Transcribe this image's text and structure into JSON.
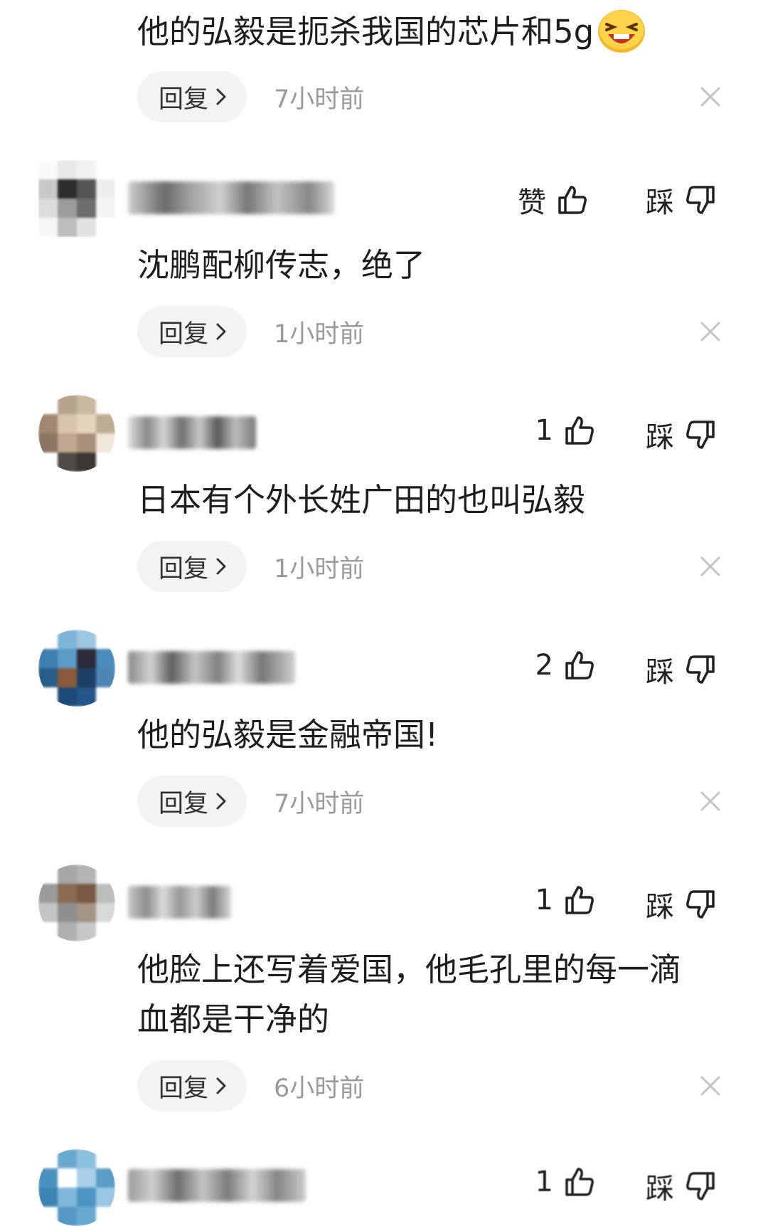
{
  "icons": {
    "reply_chevron": "chevron-right-icon",
    "like": "thumbs-up-icon",
    "dislike": "thumbs-down-icon",
    "close": "close-icon",
    "emoji": "laughing-emoji-icon"
  },
  "colors": {
    "background": "#ffffff",
    "reply_pill": "#f3f3f3",
    "time_text": "#9a9a9a",
    "main_text": "#1e1e1e"
  },
  "first": {
    "text": "他的弘毅是扼杀我国的芯片和5g",
    "reply_label": "回复",
    "time": "7小时前"
  },
  "comments": [
    {
      "like_label": "赞",
      "dislike_label": "踩",
      "text": "沈鹏配柳传志，绝了",
      "reply_label": "回复",
      "time": "1小时前"
    },
    {
      "like_label": "1",
      "dislike_label": "踩",
      "text": "日本有个外长姓广田的也叫弘毅",
      "reply_label": "回复",
      "time": "1小时前"
    },
    {
      "like_label": "2",
      "dislike_label": "踩",
      "text": "他的弘毅是金融帝国!",
      "reply_label": "回复",
      "time": "7小时前"
    },
    {
      "like_label": "1",
      "dislike_label": "踩",
      "text_line1": "他脸上还写着爱国，他毛孔里的每一滴",
      "text_line2": "血都是干净的",
      "reply_label": "回复",
      "time": "6小时前"
    },
    {
      "like_label": "1",
      "dislike_label": "踩"
    }
  ]
}
